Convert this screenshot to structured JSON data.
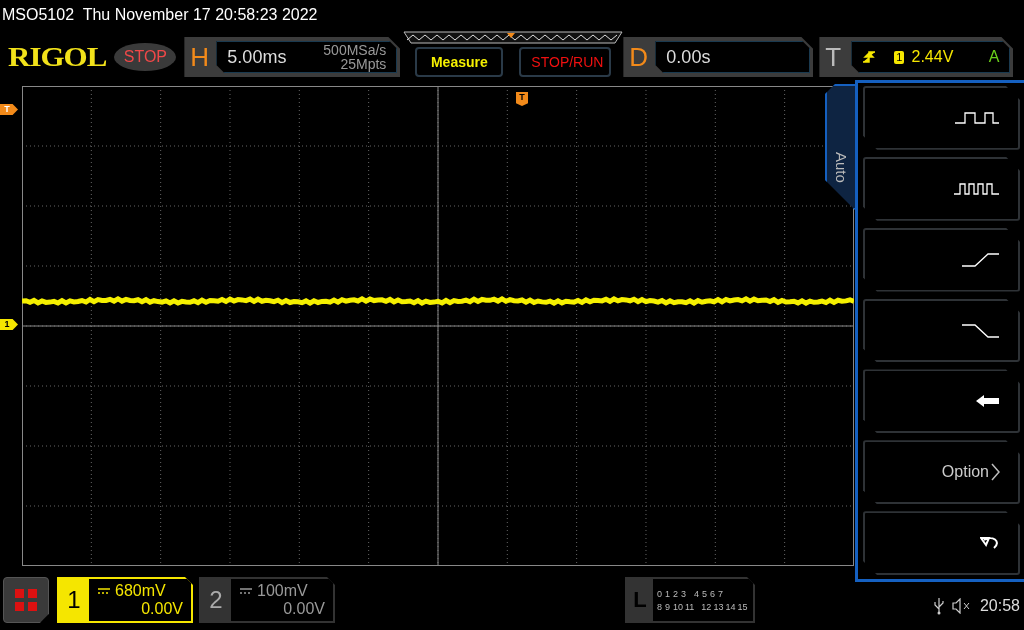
{
  "title_bar": {
    "text": "MSO5102  Thu November 17 20:58:23 2022"
  },
  "toolbar": {
    "logo": "RIGOL",
    "run_state": "STOP",
    "horizontal": {
      "label": "H",
      "timebase": "5.00ms",
      "sample_rate": "500MSa/s",
      "memory_depth": "25Mpts"
    },
    "measure_button": "Measure",
    "stop_run_button": "STOP/RUN",
    "delay": {
      "label": "D",
      "value": "0.00s"
    },
    "trigger": {
      "label": "T",
      "source": "1",
      "level": "2.44V",
      "mode": "A"
    }
  },
  "markers": {
    "trigger_position": "T",
    "trigger_level": "T",
    "channel_1": "1"
  },
  "side_menu": {
    "tab": "Auto",
    "items": [
      {
        "kind": "square"
      },
      {
        "kind": "pulses"
      },
      {
        "kind": "rise"
      },
      {
        "kind": "fall"
      },
      {
        "kind": "back"
      },
      {
        "kind": "option",
        "label": "Option"
      },
      {
        "kind": "undo"
      }
    ]
  },
  "channels": [
    {
      "number": "1",
      "scale": "680mV",
      "offset": "0.00V",
      "selected": true
    },
    {
      "number": "2",
      "scale": "100mV",
      "offset": "0.00V",
      "selected": false
    }
  ],
  "logic": {
    "label": "L",
    "row_1": [
      "0",
      "1",
      "2",
      "3",
      "4",
      "5",
      "6",
      "7"
    ],
    "row_2": [
      "8",
      "9",
      "10",
      "11",
      "12",
      "13",
      "14",
      "15"
    ]
  },
  "status": {
    "time": "20:58"
  }
}
